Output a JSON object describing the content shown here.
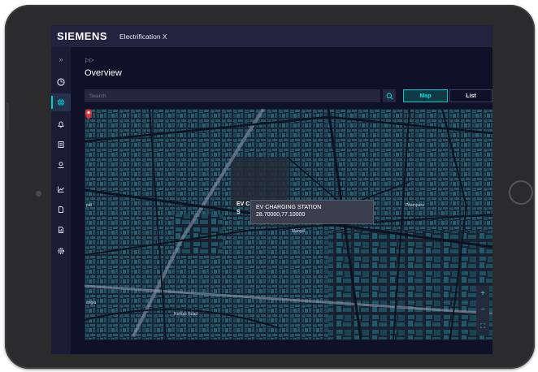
{
  "header": {
    "brand": "SIEMENS",
    "app_title": "Electrification X"
  },
  "sidebar": {
    "expand_icon": "chevrons-right-icon",
    "items": [
      {
        "icon": "gauge-icon",
        "active": false
      },
      {
        "icon": "globe-icon",
        "active": true
      },
      {
        "icon": "bell-icon",
        "active": false
      },
      {
        "icon": "book-icon",
        "active": false
      },
      {
        "icon": "user-pin-icon",
        "active": false
      },
      {
        "icon": "trend-chart-icon",
        "active": false
      },
      {
        "icon": "document-icon",
        "active": false
      },
      {
        "icon": "report-icon",
        "active": false
      },
      {
        "icon": "settings-icon",
        "active": false
      }
    ]
  },
  "page": {
    "title": "Overview"
  },
  "search": {
    "placeholder": "Search"
  },
  "view_tabs": {
    "map": "Map",
    "list": "List",
    "active": "map"
  },
  "map": {
    "popup_title": "EV CHARGING STATION",
    "popup_coords": "28.70000,77.10000",
    "partial_label_1": "EV C",
    "partial_label_2": "S",
    "street_labels": [
      "pat",
      "Mangol",
      "Pitampura",
      "angla",
      "Rohtak Road"
    ],
    "zoom_in": "+",
    "zoom_out": "−",
    "fullscreen": "⛶",
    "accent_color": "#00cccc",
    "pin_color": "#e0303a"
  }
}
